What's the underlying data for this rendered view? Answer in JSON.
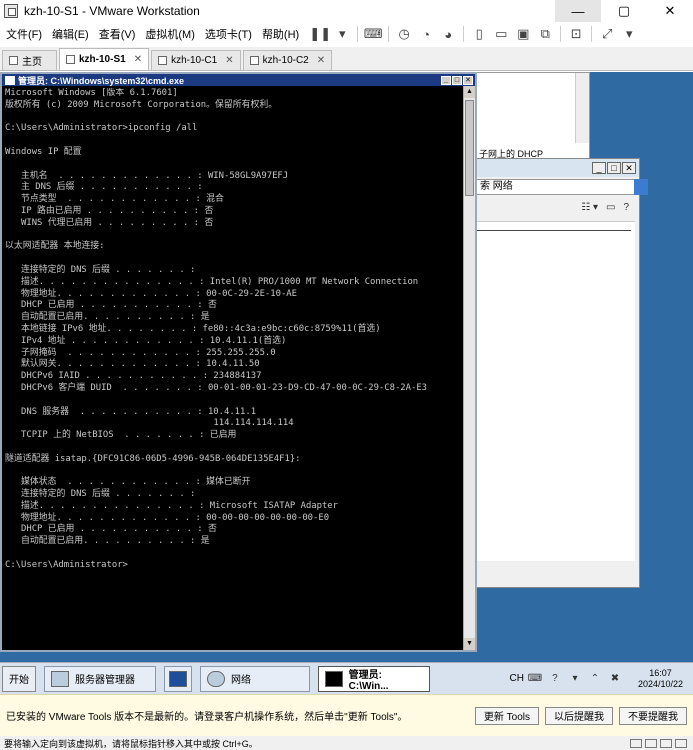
{
  "window": {
    "title": "kzh-10-S1 - VMware Workstation",
    "min": "—",
    "max": "▢",
    "close": "✕"
  },
  "menu": [
    "文件(F)",
    "编辑(E)",
    "查看(V)",
    "虚拟机(M)",
    "选项卡(T)",
    "帮助(H)"
  ],
  "tabs": [
    {
      "label": "主页",
      "close": ""
    },
    {
      "label": "kzh-10-S1",
      "close": "✕"
    },
    {
      "label": "kzh-10-C1",
      "close": "✕"
    },
    {
      "label": "kzh-10-C2",
      "close": "✕"
    }
  ],
  "bg_window": {
    "dhcp_text": "子网上的 DHCP",
    "search_text": "索 网络"
  },
  "cmd": {
    "title": "管理员: C:\\Windows\\system32\\cmd.exe",
    "lines": [
      "Microsoft Windows [版本 6.1.7601]",
      "版权所有 (c) 2009 Microsoft Corporation。保留所有权利。",
      "",
      "C:\\Users\\Administrator>ipconfig /all",
      "",
      "Windows IP 配置",
      "",
      "   主机名  . . . . . . . . . . . . . : WIN-58GL9A97EFJ",
      "   主 DNS 后缀 . . . . . . . . . . . :",
      "   节点类型  . . . . . . . . . . . . : 混合",
      "   IP 路由已启用 . . . . . . . . . . : 否",
      "   WINS 代理已启用 . . . . . . . . . : 否",
      "",
      "以太网适配器 本地连接:",
      "",
      "   连接特定的 DNS 后缀 . . . . . . . :",
      "   描述. . . . . . . . . . . . . . . : Intel(R) PRO/1000 MT Network Connection",
      "   物理地址. . . . . . . . . . . . . : 00-0C-29-2E-10-AE",
      "   DHCP 已启用 . . . . . . . . . . . : 否",
      "   自动配置已启用. . . . . . . . . . : 是",
      "   本地链接 IPv6 地址. . . . . . . . : fe80::4c3a:e9bc:c60c:8759%11(首选)",
      "   IPv4 地址 . . . . . . . . . . . . : 10.4.11.1(首选)",
      "   子网掩码  . . . . . . . . . . . . : 255.255.255.0",
      "   默认网关. . . . . . . . . . . . . : 10.4.11.50",
      "   DHCPv6 IAID . . . . . . . . . . . : 234884137",
      "   DHCPv6 客户端 DUID  . . . . . . . : 00-01-00-01-23-D9-CD-47-00-0C-29-C8-2A-E3",
      "",
      "   DNS 服务器  . . . . . . . . . . . : 10.4.11.1",
      "                                       114.114.114.114",
      "   TCPIP 上的 NetBIOS  . . . . . . . : 已启用",
      "",
      "隧道适配器 isatap.{DFC91C86-06D5-4996-945B-064DE135E4F1}:",
      "",
      "   媒体状态  . . . . . . . . . . . . : 媒体已断开",
      "   连接特定的 DNS 后缀 . . . . . . . :",
      "   描述. . . . . . . . . . . . . . . : Microsoft ISATAP Adapter",
      "   物理地址. . . . . . . . . . . . . : 00-00-00-00-00-00-00-E0",
      "   DHCP 已启用 . . . . . . . . . . . : 否",
      "   自动配置已启用. . . . . . . . . . : 是",
      "",
      "C:\\Users\\Administrator>"
    ]
  },
  "taskbar": {
    "start": "开始",
    "items": [
      {
        "label": "服务器管理器"
      },
      {
        "label": ""
      },
      {
        "label": "网络"
      },
      {
        "label": "管理员: C:\\Win..."
      }
    ],
    "lang": "CH",
    "time": "16:07",
    "date": "2024/10/22"
  },
  "notify": {
    "message": "已安装的 VMware Tools 版本不是最新的。请登录客户机操作系统，然后单击\"更新 Tools\"。",
    "update_button": "更新 Tools",
    "later_button": "以后提醒我",
    "never_button": "不要提醒我"
  },
  "status": {
    "text": "要将输入定向到该虚拟机，请将鼠标指针移入其中或按 Ctrl+G。"
  }
}
